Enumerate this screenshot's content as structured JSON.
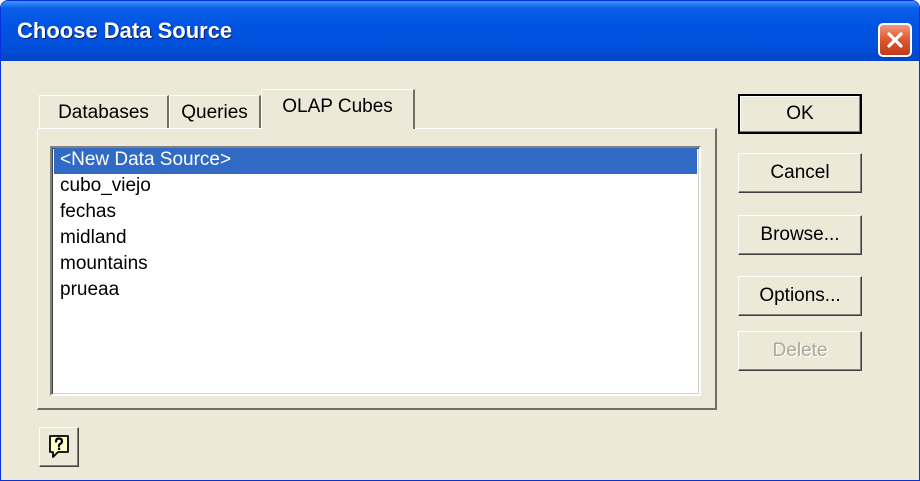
{
  "dialog": {
    "title": "Choose Data Source",
    "close_icon": "close-icon"
  },
  "tabs": [
    {
      "label": "Databases",
      "active": false
    },
    {
      "label": "Queries",
      "active": false
    },
    {
      "label": "OLAP Cubes",
      "active": true
    }
  ],
  "list": {
    "items": [
      {
        "label": "<New Data Source>",
        "selected": true
      },
      {
        "label": "cubo_viejo",
        "selected": false
      },
      {
        "label": "fechas",
        "selected": false
      },
      {
        "label": "midland",
        "selected": false
      },
      {
        "label": "mountains",
        "selected": false
      },
      {
        "label": "prueaa",
        "selected": false
      }
    ]
  },
  "buttons": {
    "ok": "OK",
    "cancel": "Cancel",
    "browse": "Browse...",
    "options": "Options...",
    "delete": "Delete",
    "delete_enabled": false
  },
  "help": {
    "icon": "help-icon"
  },
  "colors": {
    "titlebar": "#0054e3",
    "selection": "#316ac5",
    "face": "#ece9d8",
    "close": "#e05b35"
  }
}
